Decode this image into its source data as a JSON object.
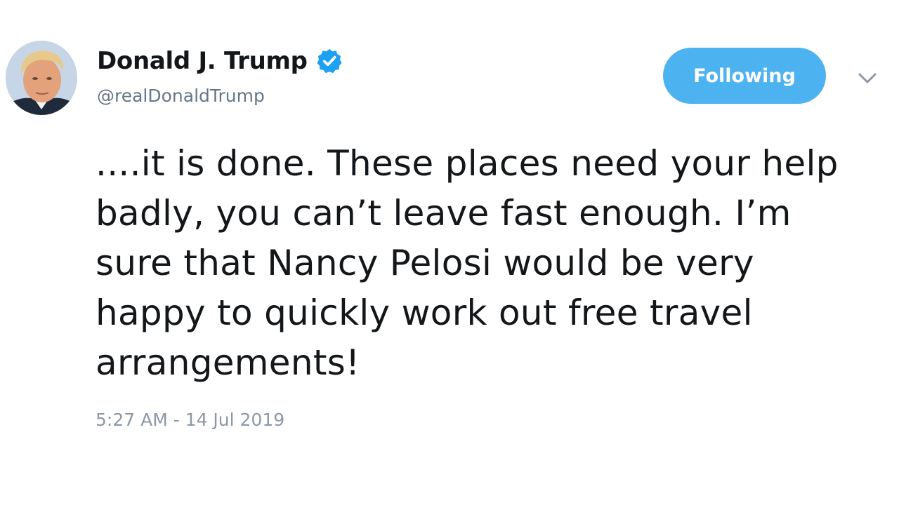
{
  "author": {
    "display_name": "Donald J. Trump",
    "handle": "@realDonaldTrump",
    "avatar_icon": "profile-photo",
    "verified_icon": "verified-badge-icon"
  },
  "follow_button": {
    "label": "Following"
  },
  "menu": {
    "icon": "chevron-down-icon"
  },
  "tweet": {
    "text": "....it is done. These places need your help badly, you can’t leave fast enough. I’m sure that Nancy Pelosi would be very happy to quickly work out free travel arrangements!",
    "timestamp": "5:27 AM - 14 Jul 2019"
  },
  "colors": {
    "accent": "#1da1f2",
    "button_bg": "#4db2f0",
    "text_primary": "#14171a",
    "text_secondary": "#657786"
  }
}
